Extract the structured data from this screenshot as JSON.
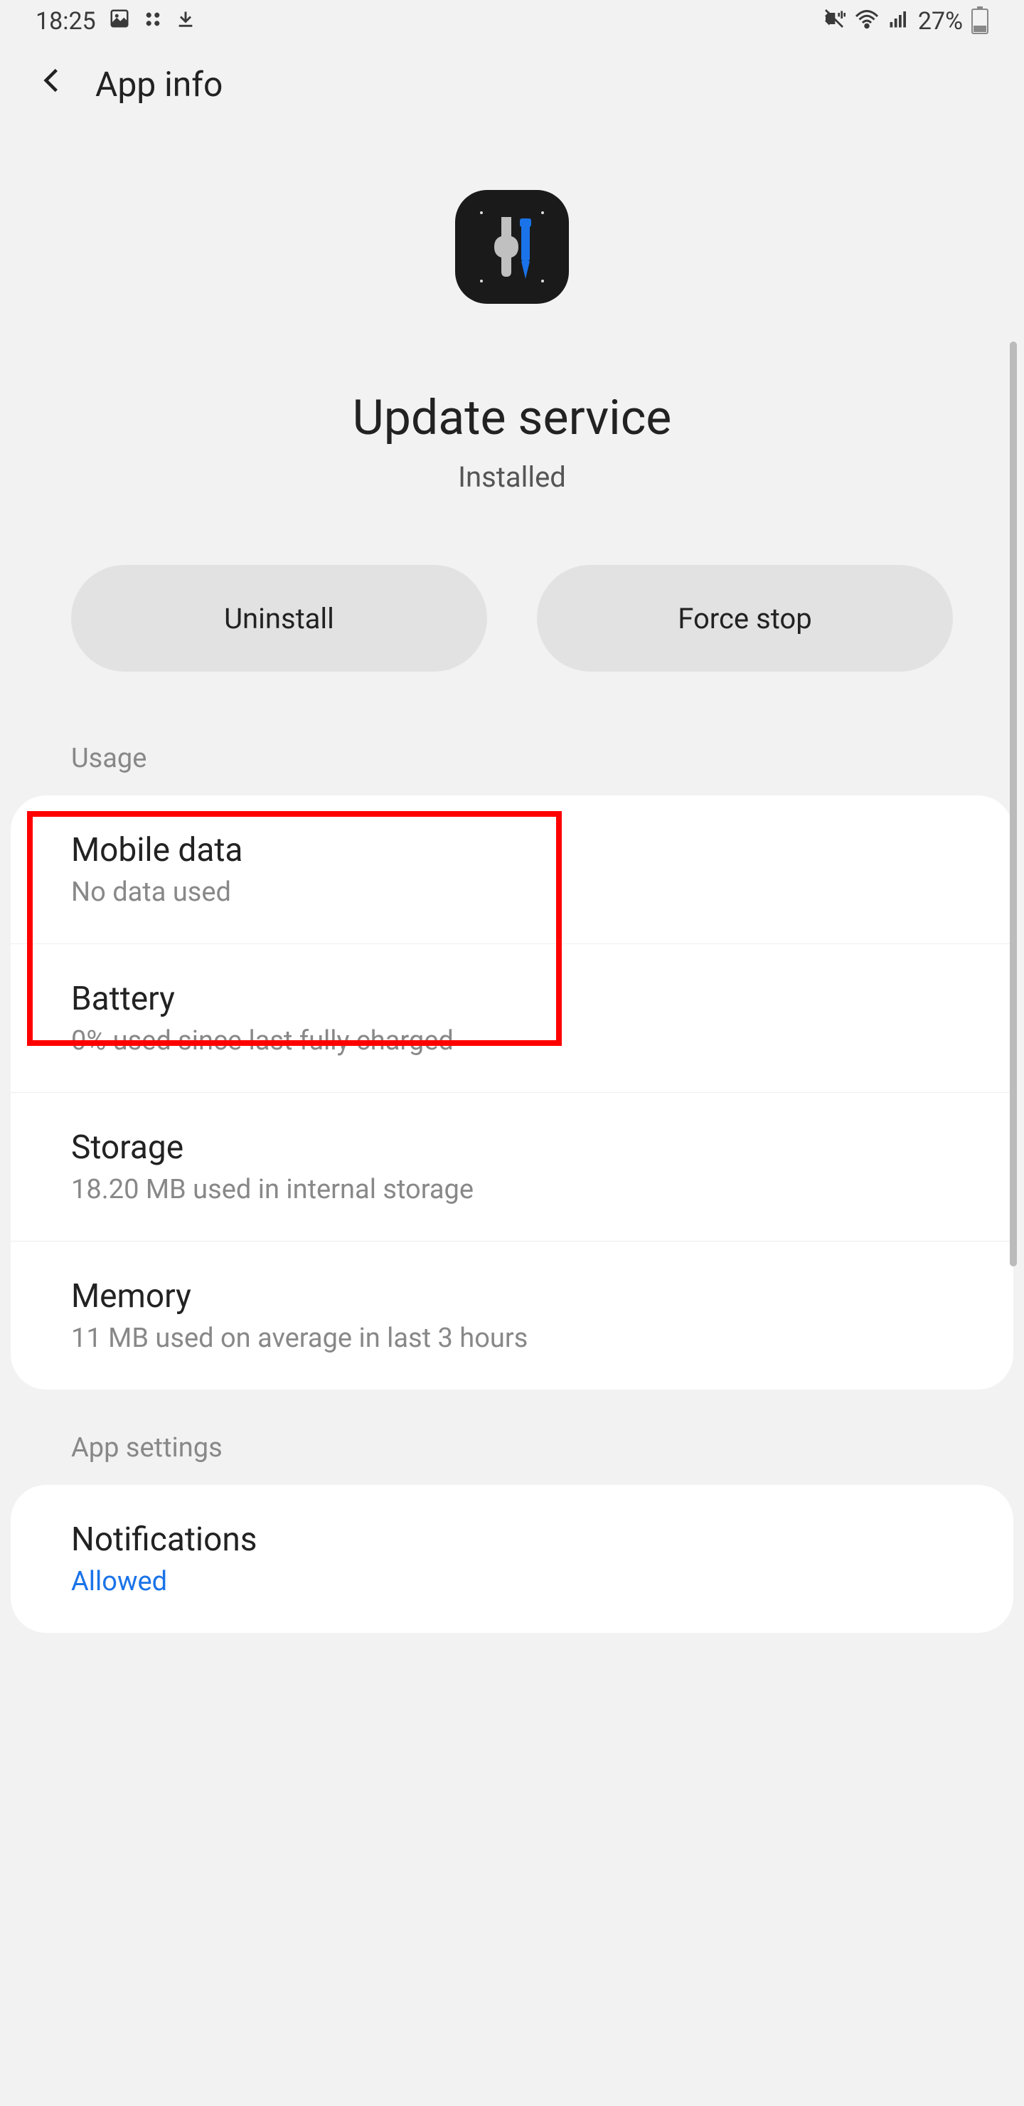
{
  "status_bar": {
    "time": "18:25",
    "battery_percent": "27%"
  },
  "header": {
    "title": "App info"
  },
  "app": {
    "name": "Update service",
    "status": "Installed"
  },
  "actions": {
    "uninstall": "Uninstall",
    "force_stop": "Force stop"
  },
  "sections": {
    "usage_label": "Usage",
    "app_settings_label": "App settings"
  },
  "usage": {
    "mobile_data": {
      "title": "Mobile data",
      "subtitle": "No data used"
    },
    "battery": {
      "title": "Battery",
      "subtitle": "0% used since last fully charged"
    },
    "storage": {
      "title": "Storage",
      "subtitle": "18.20 MB used in internal storage"
    },
    "memory": {
      "title": "Memory",
      "subtitle": "11 MB used on average in last 3 hours"
    }
  },
  "app_settings": {
    "notifications": {
      "title": "Notifications",
      "subtitle": "Allowed"
    }
  }
}
